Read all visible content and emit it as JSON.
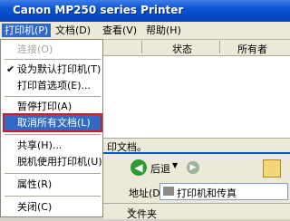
{
  "window": {
    "title": "Canon MP250 series Printer"
  },
  "menubar": [
    {
      "label": "打印机(P)"
    },
    {
      "label": "文档(D)"
    },
    {
      "label": "查看(V)"
    },
    {
      "label": "帮助(H)"
    }
  ],
  "list_header": {
    "col_status": "状态",
    "col_owner": "所有者"
  },
  "printer_menu": [
    {
      "label": "连接(O)",
      "disabled": true
    },
    {
      "label": "设为默认打印机(T)",
      "checked": true
    },
    {
      "label": "打印首选项(E)..."
    },
    {
      "label": "暂停打印(A)"
    },
    {
      "label": "取消所有文档(L)",
      "highlighted": true
    },
    {
      "label": "共享(H)..."
    },
    {
      "label": "脱机使用打印机(U)"
    },
    {
      "label": "属性(R)"
    },
    {
      "label": "关闭(C)"
    }
  ],
  "status_text": "印文档。",
  "explorer": {
    "back_label": "后退",
    "address_label": "地址(D)",
    "address_value": "打印机和传真",
    "folders_label": "文件夹",
    "close_glyph": "✕"
  },
  "icons": {
    "printer": "printer-icon",
    "check": "checkmark-icon",
    "back": "back-arrow-icon",
    "forward": "forward-arrow-icon",
    "up": "folder-up-icon"
  }
}
